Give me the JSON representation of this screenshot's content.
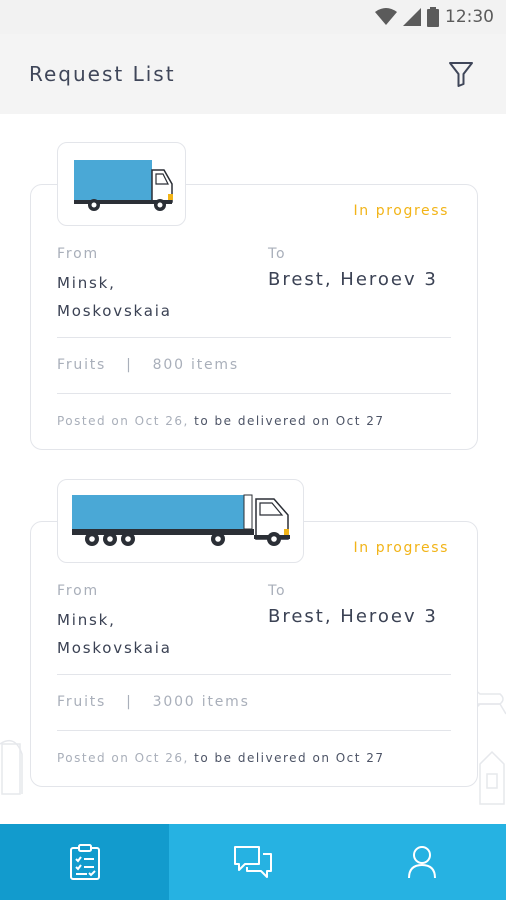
{
  "status_bar": {
    "time": "12:30"
  },
  "header": {
    "title": "Request List"
  },
  "requests": [
    {
      "status": "In progress",
      "from_label": "From",
      "from_value": "Minsk,\nMoskovskaia",
      "to_label": "To",
      "to_value": "Brest, Heroev 3",
      "cargo_type": "Fruits",
      "separator": "|",
      "cargo_count": "800 items",
      "posted_text": "Posted on Oct 26,",
      "delivery_text": " to be delivered on Oct 27",
      "vehicle_icon": "box-truck-icon"
    },
    {
      "status": "In progress",
      "from_label": "From",
      "from_value": "Minsk,\nMoskovskaia",
      "to_label": "To",
      "to_value": "Brest, Heroev 3",
      "cargo_type": "Fruits",
      "separator": "|",
      "cargo_count": "3000 items",
      "posted_text": "Posted on Oct 26,",
      "delivery_text": " to be delivered on Oct 27",
      "vehicle_icon": "semi-truck-icon"
    }
  ],
  "bottom_nav": [
    {
      "icon": "clipboard-checklist-icon",
      "active": true
    },
    {
      "icon": "chat-bubbles-icon",
      "active": false
    },
    {
      "icon": "user-profile-icon",
      "active": false
    }
  ],
  "colors": {
    "accent": "#26b2e2",
    "accent_dark": "#129bcd",
    "status_in_progress": "#f2b418",
    "truck_body": "#4aa8d6"
  }
}
